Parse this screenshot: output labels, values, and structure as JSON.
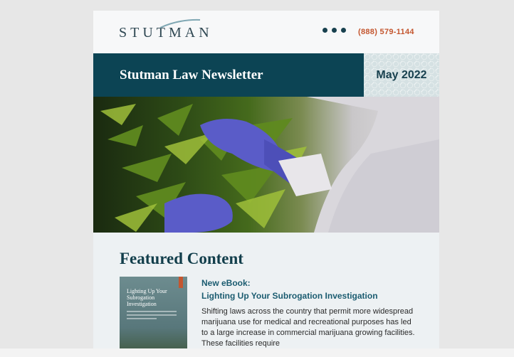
{
  "header": {
    "logo_text": "STUTMAN",
    "menu_icon": "more-dots-icon",
    "phone": "(888) 579-1144"
  },
  "banner": {
    "title": "Stutman Law Newsletter",
    "date": "May 2022"
  },
  "hero": {
    "image": "gloved-hands-inspecting-cannabis-plants"
  },
  "featured": {
    "heading": "Featured Content",
    "ebook_cover_title": "Lighting Up Your Subrogation Investigation",
    "article_kicker": "New eBook:",
    "article_title": "Lighting Up Your Subrogation Investigation",
    "article_body": "Shifting laws across the country that permit more widespread marijuana use for medical and recreational purposes has led to a large increase in commercial marijuana growing facilities. These facilities require"
  },
  "colors": {
    "brand_navy": "#0c4454",
    "accent_orange": "#c4562f",
    "link_teal": "#1b5c70",
    "page_bg": "#e7e7e7"
  }
}
